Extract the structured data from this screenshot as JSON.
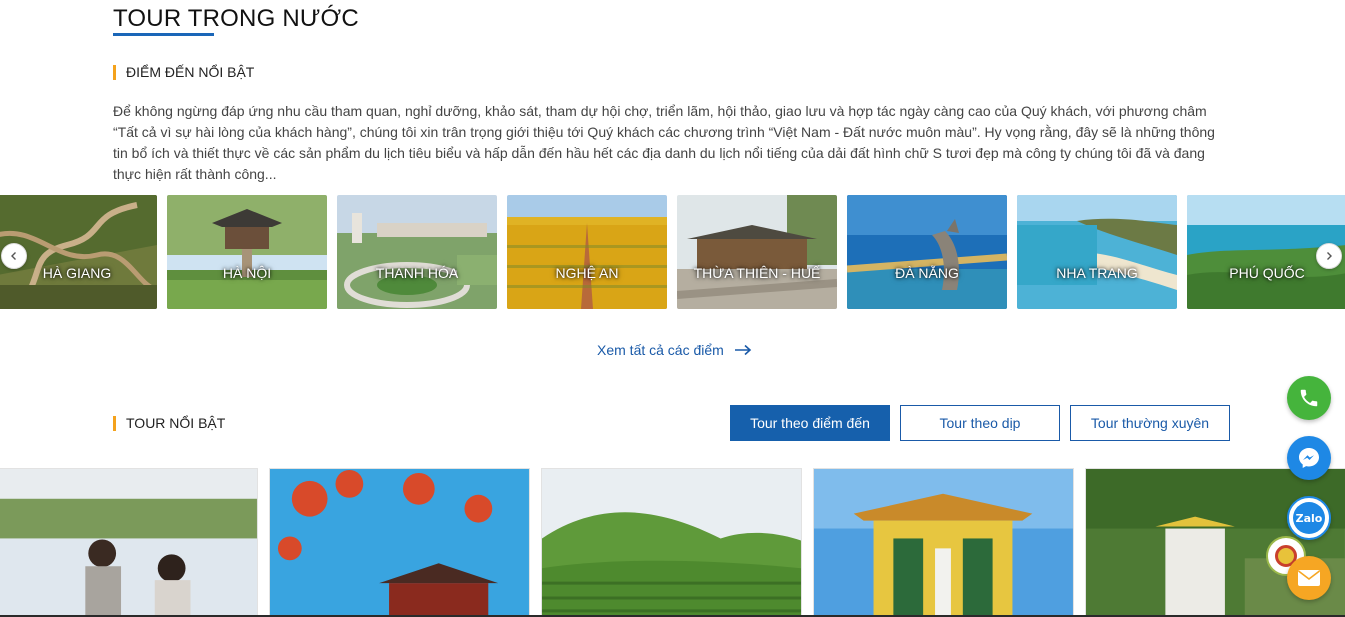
{
  "page": {
    "title": "TOUR TRONG NƯỚC"
  },
  "highlights": {
    "heading": "ĐIỂM ĐẾN NỔI BẬT",
    "intro": "Để không ngừng đáp ứng nhu cầu tham quan, nghỉ dưỡng, khảo sát, tham dự hội chợ, triển lãm, hội thảo, giao lưu và hợp tác ngày càng cao của Quý khách, với phương châm “Tất cả vì sự hài lòng của khách hàng”, chúng tôi xin trân trọng giới thiệu tới Quý khách các chương trình “Việt Nam - Đất nước muôn màu”. Hy vọng rằng, đây sẽ là những thông tin bổ ích và thiết thực về các sản phẩm du lịch tiêu biểu và hấp dẫn đến hầu hết các địa danh du lịch nổi tiếng của dải đất hình chữ S tươi đẹp mà công ty chúng tôi đã và đang thực hiện rất thành công...",
    "destinations": [
      {
        "name": "HÀ GIANG"
      },
      {
        "name": "HÀ NỘI"
      },
      {
        "name": "THANH HÓA"
      },
      {
        "name": "NGHỆ AN"
      },
      {
        "name": "THỪA THIÊN - HUẾ"
      },
      {
        "name": "ĐÀ NẴNG"
      },
      {
        "name": "NHA TRANG"
      },
      {
        "name": "PHÚ QUỐC"
      }
    ],
    "see_all": "Xem tất cả các điểm"
  },
  "featured": {
    "heading": "TOUR NỔI BẬT",
    "filters": [
      {
        "label": "Tour theo điểm đến",
        "active": true
      },
      {
        "label": "Tour theo dịp",
        "active": false
      },
      {
        "label": "Tour thường xuyên",
        "active": false
      }
    ]
  },
  "contact": {
    "zalo_label": "Zalo"
  },
  "colors": {
    "accent_blue": "#1660ac",
    "accent_orange": "#f4a21c",
    "phone_green": "#45b43c",
    "messenger_blue": "#1e88e5",
    "mail_orange": "#f6a623"
  }
}
